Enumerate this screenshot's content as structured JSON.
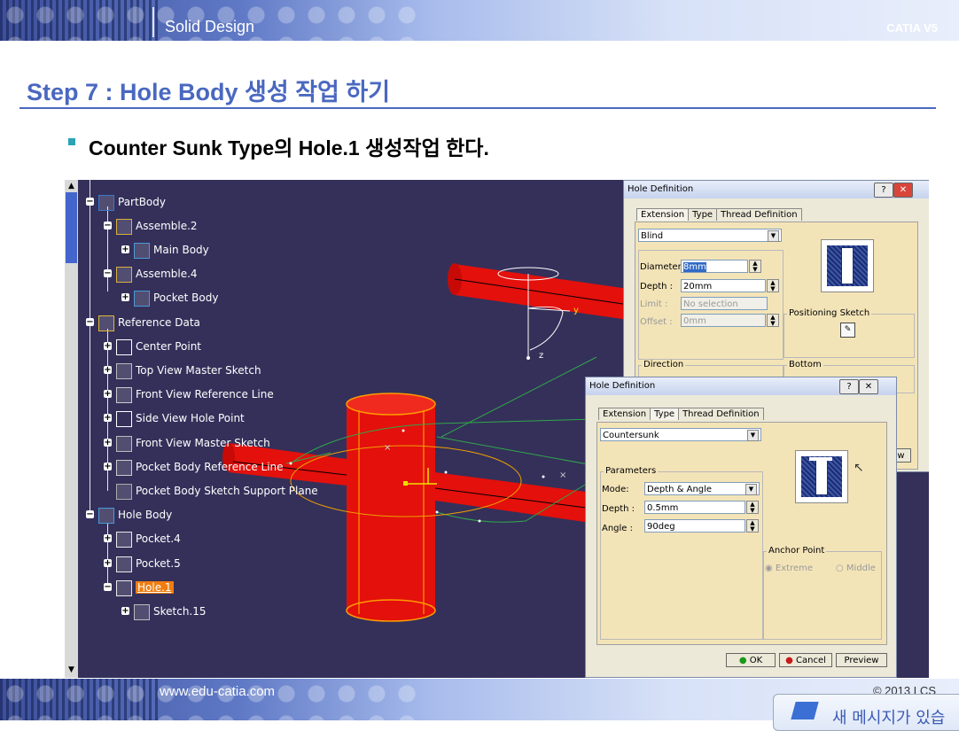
{
  "header": {
    "title": "Solid Design",
    "product": "CATIA V5"
  },
  "step_title": "Step 7 : Hole Body 생성 작업 하기",
  "bullet": "Counter Sunk Type의 Hole.1 생성작업 한다.",
  "colors": {
    "accent": "#4a68c0",
    "viewport_bg": "#34305a",
    "tube_red": "#e3100c",
    "selected_item": "#f07d10"
  },
  "tree": {
    "items": [
      {
        "label": "PartBody",
        "icon": "part-body-icon"
      },
      {
        "label": "Assemble.2",
        "icon": "assemble-icon"
      },
      {
        "label": "Main Body",
        "icon": "body-icon"
      },
      {
        "label": "Assemble.4",
        "icon": "assemble-icon"
      },
      {
        "label": "Pocket Body",
        "icon": "body-icon"
      },
      {
        "label": "Reference Data",
        "icon": "reference-data-icon"
      },
      {
        "label": "Center Point",
        "icon": "point-icon"
      },
      {
        "label": "Top View Master Sketch",
        "icon": "sketch-icon"
      },
      {
        "label": "Front View Reference Line",
        "icon": "line-icon"
      },
      {
        "label": "Side View Hole Point",
        "icon": "point-icon"
      },
      {
        "label": "Front View Master Sketch",
        "icon": "sketch-icon"
      },
      {
        "label": "Pocket Body Reference Line",
        "icon": "line-icon"
      },
      {
        "label": "Pocket Body Sketch Support Plane",
        "icon": "plane-icon"
      },
      {
        "label": "Hole Body",
        "icon": "body-icon"
      },
      {
        "label": "Pocket.4",
        "icon": "pocket-icon"
      },
      {
        "label": "Pocket.5",
        "icon": "pocket-icon"
      },
      {
        "label": "Hole.1",
        "icon": "hole-icon"
      },
      {
        "label": "Sketch.15",
        "icon": "sketch-icon"
      }
    ]
  },
  "dialog_back": {
    "title": "Hole Definition",
    "tabs": [
      "Extension",
      "Type",
      "Thread Definition"
    ],
    "extension_type": "Blind",
    "diameter_label": "Diameter :",
    "diameter_value": "8mm",
    "depth_label": "Depth :",
    "depth_value": "20mm",
    "limit_label": "Limit :",
    "limit_value": "No selection",
    "offset_label": "Offset :",
    "offset_value": "0mm",
    "positioning_sketch": "Positioning Sketch",
    "direction_label": "Direction",
    "bottom_label": "Bottom",
    "preview_partial": "iew"
  },
  "dialog_front": {
    "title": "Hole Definition",
    "tabs": [
      "Extension",
      "Type",
      "Thread Definition"
    ],
    "hole_type": "Countersunk",
    "parameters_label": "Parameters",
    "mode_label": "Mode:",
    "mode_value": "Depth & Angle",
    "depth_label": "Depth :",
    "depth_value": "0.5mm",
    "angle_label": "Angle :",
    "angle_value": "90deg",
    "anchor_label": "Anchor Point",
    "anchor_extreme": "Extreme",
    "anchor_middle": "Middle",
    "ok": "OK",
    "cancel": "Cancel",
    "preview": "Preview"
  },
  "axis_labels": {
    "y": "y",
    "z": "z"
  },
  "footer": {
    "url": "www.edu-catia.com",
    "copyright": "© 2013 LCS"
  },
  "popup": {
    "text": "새 메시지가 있습"
  }
}
